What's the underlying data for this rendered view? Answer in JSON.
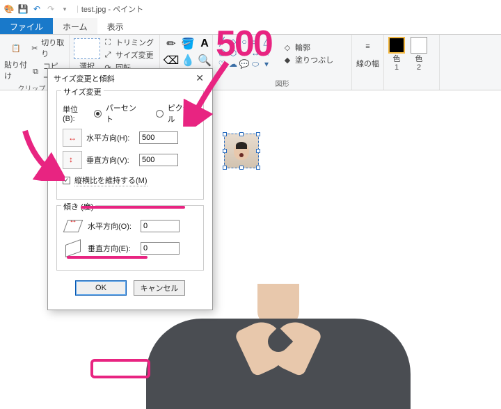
{
  "title": {
    "filename": "test.jpg",
    "app": "ペイント",
    "sep": " - "
  },
  "qat": {
    "save": "💾",
    "undo": "↶",
    "redo": "↷"
  },
  "tabs": {
    "file": "ファイル",
    "home": "ホーム",
    "view": "表示"
  },
  "ribbon": {
    "clipboard": {
      "paste": "貼り付け",
      "cut": "切り取り",
      "copy": "コピー",
      "group": "クリップ..."
    },
    "image": {
      "select": "選択",
      "crop": "トリミング",
      "resize": "サイズ変更",
      "rotate": "回転"
    },
    "tools": {
      "pencil": "✏",
      "fill": "🪣",
      "text": "A",
      "eraser": "⌫",
      "picker": "💧",
      "zoom": "🔍"
    },
    "shapes": {
      "outline": "輪郭",
      "fill": "塗りつぶし",
      "group": "図形"
    },
    "stroke": {
      "label": "線の幅"
    },
    "colors": {
      "c1": "色\n1",
      "c2": "色\n2"
    }
  },
  "dialog": {
    "title": "サイズ変更と傾斜",
    "resize": {
      "legend": "サイズ変更",
      "unit_label": "単位(B):",
      "percent": "パーセント",
      "pixel": "ピクセル",
      "h_label": "水平方向(H):",
      "h_value": "500",
      "v_label": "垂直方向(V):",
      "v_value": "500",
      "aspect": "縦横比を維持する(M)"
    },
    "skew": {
      "legend": "傾き (度)",
      "h_label": "水平方向(O):",
      "h_value": "0",
      "v_label": "垂直方向(E):",
      "v_value": "0"
    },
    "ok": "OK",
    "cancel": "キャンセル"
  },
  "annotation": {
    "big_number": "500"
  }
}
